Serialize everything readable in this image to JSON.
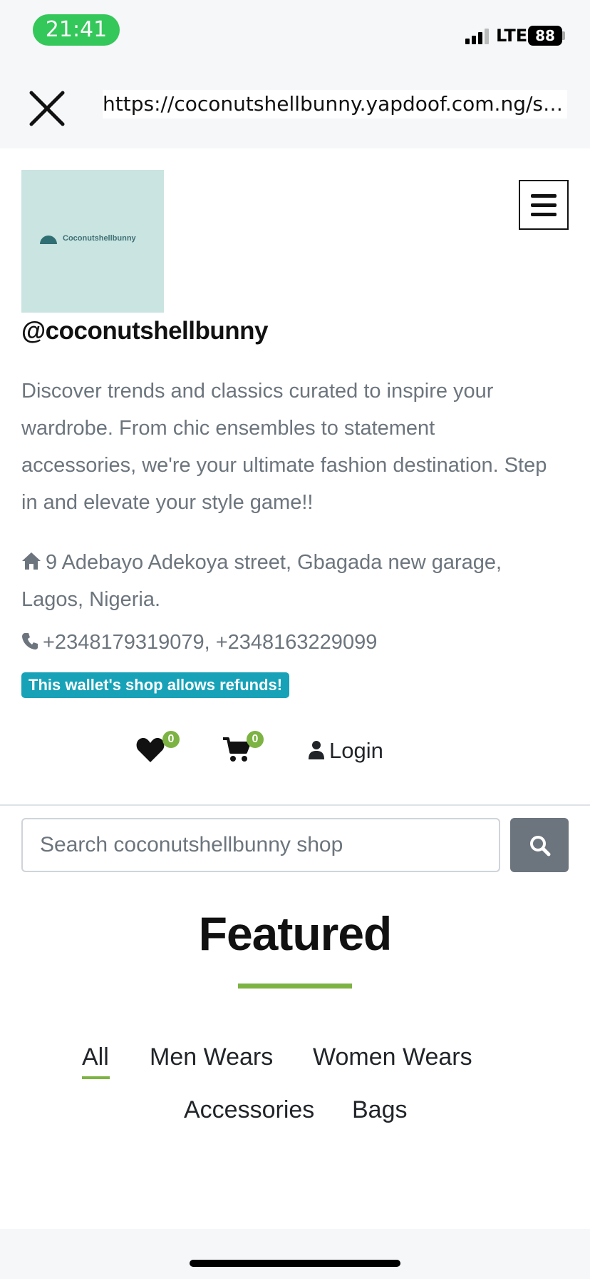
{
  "status_bar": {
    "time": "21:41",
    "network": "LTE",
    "battery": "88"
  },
  "browser": {
    "url": "https://coconutshellbunny.yapdoof.com.ng/shop"
  },
  "shop": {
    "logo_text": "Coconutshellbunny",
    "handle": "@coconutshellbunny",
    "description": "Discover trends and classics curated to inspire your wardrobe. From chic ensembles to statement accessories, we're your ultimate fashion destination. Step in and elevate your style game!!",
    "address": "9 Adebayo Adekoya street, Gbagada new garage, Lagos, Nigeria.",
    "phone": "+2348179319079, +2348163229099",
    "refund_badge": "This wallet's shop allows refunds!"
  },
  "actions": {
    "wishlist_count": "0",
    "cart_count": "0",
    "login_label": "Login"
  },
  "search": {
    "placeholder": "Search coconutshellbunny shop"
  },
  "featured": {
    "title": "Featured",
    "tabs": [
      "All",
      "Men Wears",
      "Women Wears",
      "Accessories",
      "Bags"
    ],
    "active_tab": "All"
  },
  "colors": {
    "accent_green": "#7cb342",
    "badge_teal": "#17a2b8",
    "status_green": "#34c759",
    "search_button": "#6c757d"
  }
}
